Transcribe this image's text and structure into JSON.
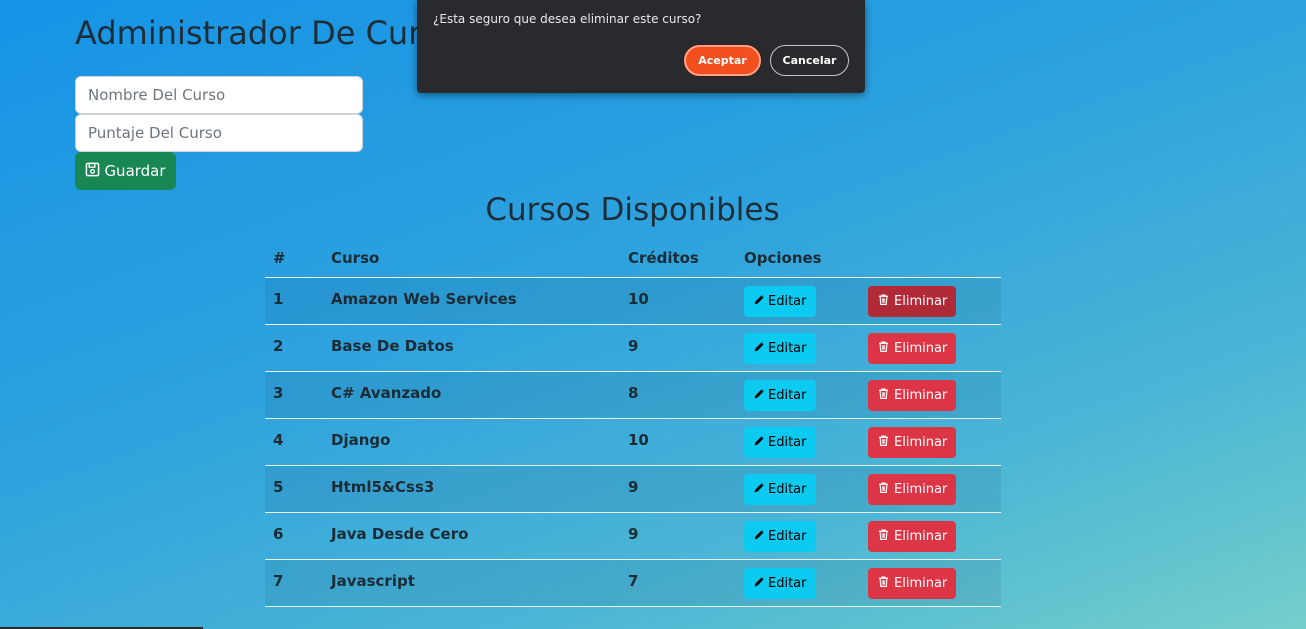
{
  "header": {
    "title": "Administrador De Cursos"
  },
  "form": {
    "name_placeholder": "Nombre Del Curso",
    "score_placeholder": "Puntaje Del Curso",
    "save_label": "Guardar",
    "save_icon": "floppy-disk-icon"
  },
  "list": {
    "title": "Cursos Disponibles",
    "columns": [
      "#",
      "Curso",
      "Créditos",
      "Opciones"
    ],
    "edit_label": "Editar",
    "edit_icon": "pencil-icon",
    "delete_label": "Eliminar",
    "delete_icon": "trash-icon",
    "rows": [
      {
        "num": "1",
        "name": "Amazon Web Services",
        "credits": "10"
      },
      {
        "num": "2",
        "name": "Base De Datos",
        "credits": "9"
      },
      {
        "num": "3",
        "name": "C# Avanzado",
        "credits": "8"
      },
      {
        "num": "4",
        "name": "Django",
        "credits": "10"
      },
      {
        "num": "5",
        "name": "Html5&Css3",
        "credits": "9"
      },
      {
        "num": "6",
        "name": "Java Desde Cero",
        "credits": "9"
      },
      {
        "num": "7",
        "name": "Javascript",
        "credits": "7"
      }
    ]
  },
  "dialog": {
    "message": "¿Esta seguro que desea eliminar este curso?",
    "accept_label": "Aceptar",
    "cancel_label": "Cancelar"
  },
  "colors": {
    "save": "#198754",
    "edit": "#0dcaf0",
    "delete": "#dc3545",
    "accept": "#f24e1e",
    "dialog_bg": "#292a2d"
  }
}
